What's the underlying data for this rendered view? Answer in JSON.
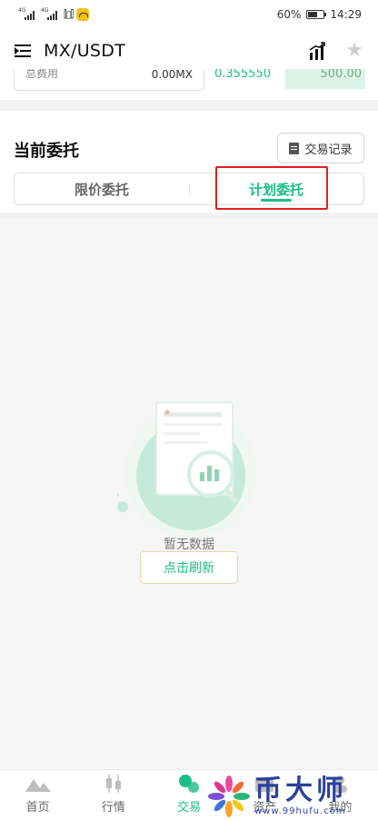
{
  "status_bar": {
    "network_1": "4G",
    "network_2": "4G",
    "battery_percent": "60%",
    "time": "14:29"
  },
  "header": {
    "pair": "MX/USDT",
    "menu_icon": "menu-collapse-icon",
    "chart_icon": "bar-chart-icon",
    "favorite_icon": "star-icon"
  },
  "order_peek": {
    "label": "总费用",
    "value": "0.00MX",
    "price": "0.355550",
    "depth_value": "500.00"
  },
  "orders": {
    "title": "当前委托",
    "record_button": "交易记录",
    "tabs": [
      {
        "label": "限价委托",
        "active": false
      },
      {
        "label": "计划委托",
        "active": true
      }
    ]
  },
  "empty_state": {
    "message": "暂无数据",
    "refresh_button": "点击刷新"
  },
  "bottom_nav": [
    {
      "label": "首页",
      "icon": "home-mountain-icon",
      "active": false
    },
    {
      "label": "行情",
      "icon": "candlestick-icon",
      "active": false
    },
    {
      "label": "交易",
      "icon": "trade-bubbles-icon",
      "active": true
    },
    {
      "label": "资产",
      "icon": "wallet-icon",
      "active": false
    },
    {
      "label": "我的",
      "icon": "user-icon",
      "active": false
    }
  ],
  "watermark": {
    "brand": "币大师",
    "url": "www.99hufu.com"
  },
  "colors": {
    "accent": "#1bbd88",
    "highlight_border": "#e02020",
    "watermark": "#2b3f9c"
  }
}
